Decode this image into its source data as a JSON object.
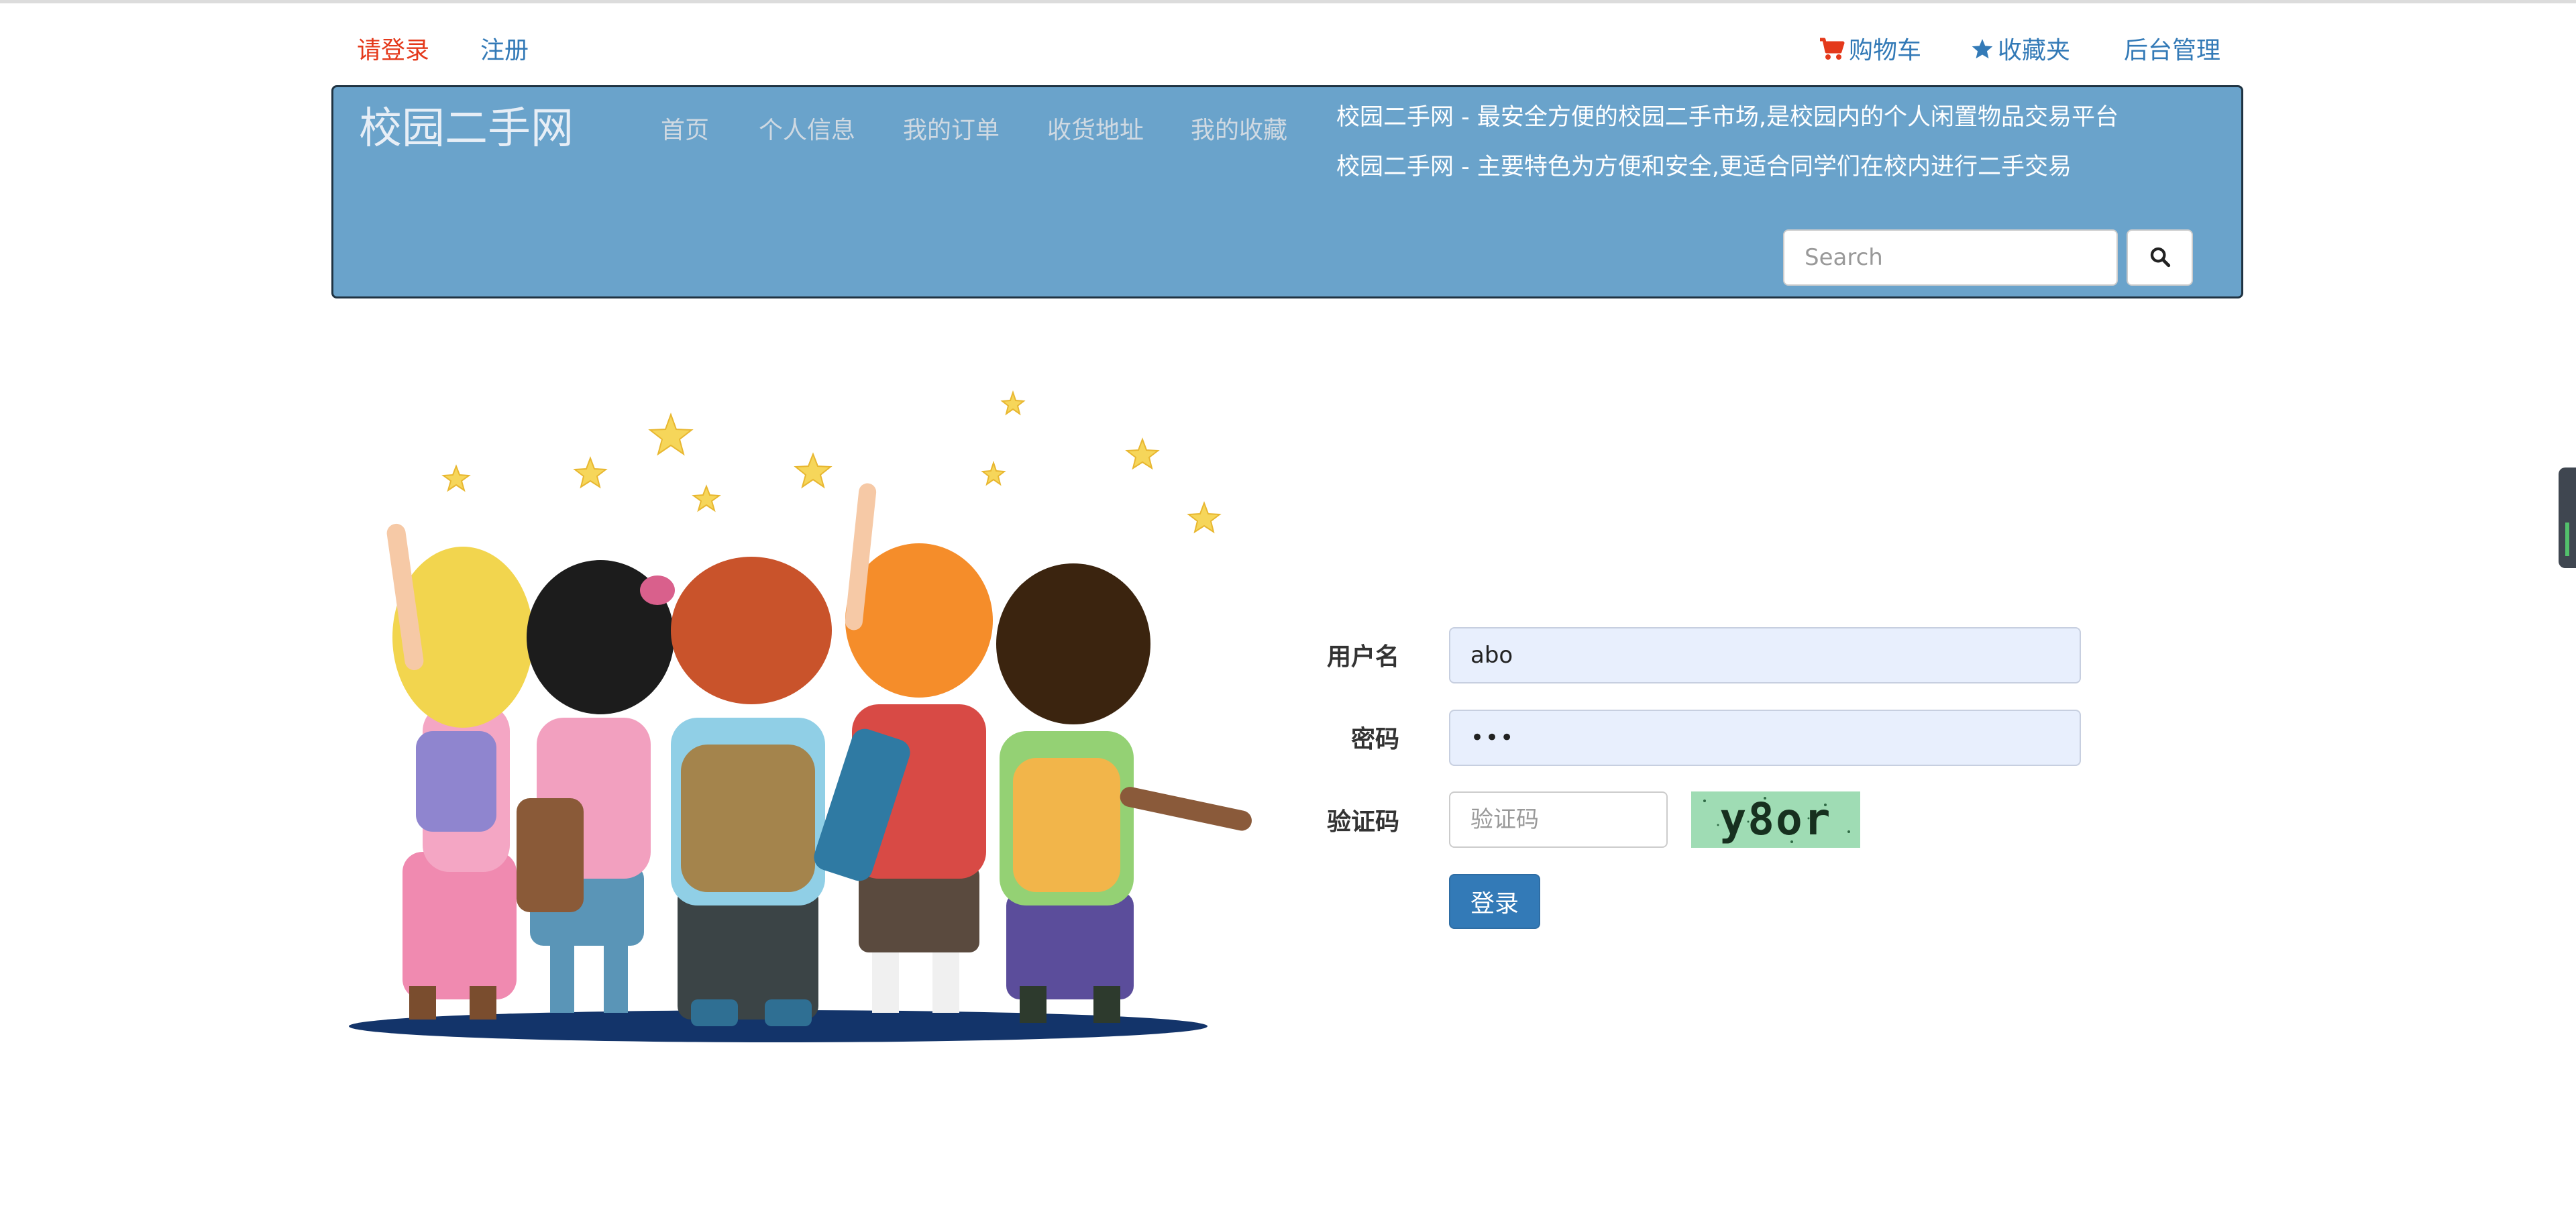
{
  "topbar": {
    "login_label": "请登录",
    "register_label": "注册",
    "cart_label": "购物车",
    "favorites_label": "收藏夹",
    "admin_label": "后台管理",
    "cart_icon": "cart-icon",
    "favorites_icon": "star-icon"
  },
  "navbar": {
    "brand": "校园二手网",
    "items": [
      {
        "label": "首页"
      },
      {
        "label": "个人信息"
      },
      {
        "label": "我的订单"
      },
      {
        "label": "收货地址"
      },
      {
        "label": "我的收藏"
      }
    ],
    "notices": [
      "校园二手网 - 最安全方便的校园二手市场,是校园内的个人闲置物品交易平台",
      "校园二手网 - 主要特色为方便和安全,更适合同学们在校内进行二手交易"
    ],
    "search_placeholder": "Search",
    "search_icon": "magnifier-icon"
  },
  "login_form": {
    "username_label": "用户名",
    "username_value": "abo",
    "password_label": "密码",
    "password_value": "•••",
    "captcha_label": "验证码",
    "captcha_placeholder": "验证码",
    "captcha_text": "y8or",
    "submit_label": "登录"
  },
  "colors": {
    "navbar_bg": "#6aa3cb",
    "link_blue": "#337ab7",
    "login_red": "#e4391b",
    "button_blue": "#337ab7",
    "autofill_bg": "#e8effd",
    "captcha_bg": "#9fdcb4"
  }
}
